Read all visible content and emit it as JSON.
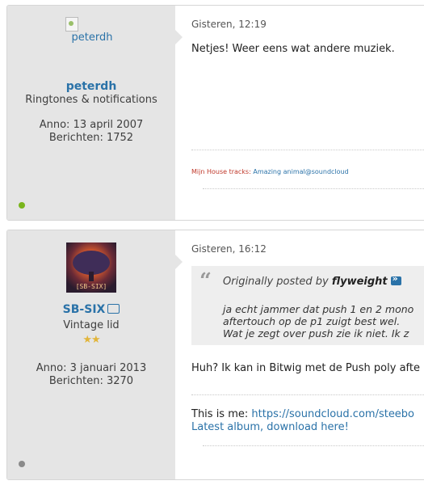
{
  "posts": [
    {
      "avatar_alt": "peterdh",
      "username": "peterdh",
      "usertitle": "Ringtones & notifications",
      "joined": "Anno: 13 april 2007",
      "posts_count": "Berichten: 1752",
      "status_color": "#7ab51d",
      "date": "Gisteren, 12:19",
      "message": "Netjes! Weer eens wat andere muziek.",
      "signature": {
        "label": "Mijn House tracks:",
        "link": "Amazing animal@soundcloud"
      }
    },
    {
      "avatar_label": "[SB-SIX]",
      "username": "SB-SIX",
      "usertitle": "Vintage lid",
      "stars": "★★",
      "joined": "Anno: 3 januari 2013",
      "posts_count": "Berichten: 3270",
      "status_color": "#8a8a8a",
      "date": "Gisteren, 16:12",
      "quote": {
        "prefix": "Originally posted by",
        "author": "flyweight",
        "lines": [
          "ja echt jammer dat push 1 en 2 mono",
          "aftertouch op de p1 zuigt best wel.",
          "Wat je zegt over push zie ik niet. Ik z"
        ]
      },
      "message": "Huh? Ik kan in Bitwig met de Push poly afte",
      "signature": {
        "label": "This is me:",
        "link": "https://soundcloud.com/steebo",
        "line2": "Latest album, download here!"
      }
    }
  ]
}
